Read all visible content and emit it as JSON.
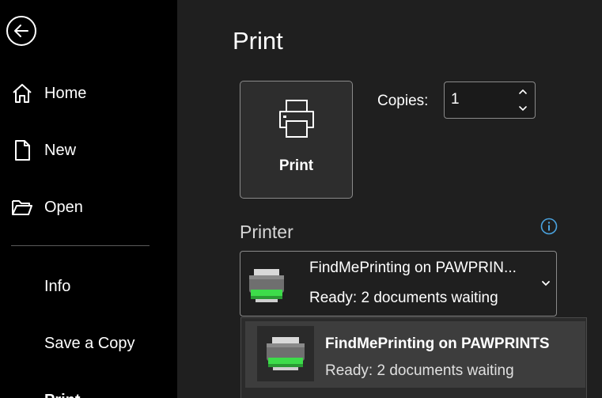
{
  "sidebar": {
    "back_icon": "back-arrow-icon",
    "items": [
      {
        "label": "Home",
        "icon": "home-icon"
      },
      {
        "label": "New",
        "icon": "new-document-icon"
      },
      {
        "label": "Open",
        "icon": "folder-open-icon"
      }
    ],
    "secondary_items": [
      {
        "label": "Info"
      },
      {
        "label": "Save a Copy"
      },
      {
        "label": "Print"
      }
    ]
  },
  "main": {
    "title": "Print",
    "print_button": {
      "label": "Print",
      "icon": "printer-icon"
    },
    "copies": {
      "label": "Copies:",
      "value": "1"
    },
    "printer_section": {
      "title": "Printer",
      "info_icon": "info-icon",
      "selected": {
        "name": "FindMePrinting on PAWPRIN...",
        "status": "Ready: 2 documents waiting"
      },
      "dropdown": [
        {
          "name": "FindMePrinting on PAWPRINTS",
          "status": "Ready: 2 documents waiting"
        }
      ]
    }
  },
  "colors": {
    "sidebar_bg": "#000000",
    "main_bg": "#1f1f1f",
    "accent_info": "#4aa3df",
    "printer_green": "#3ddc4a"
  }
}
